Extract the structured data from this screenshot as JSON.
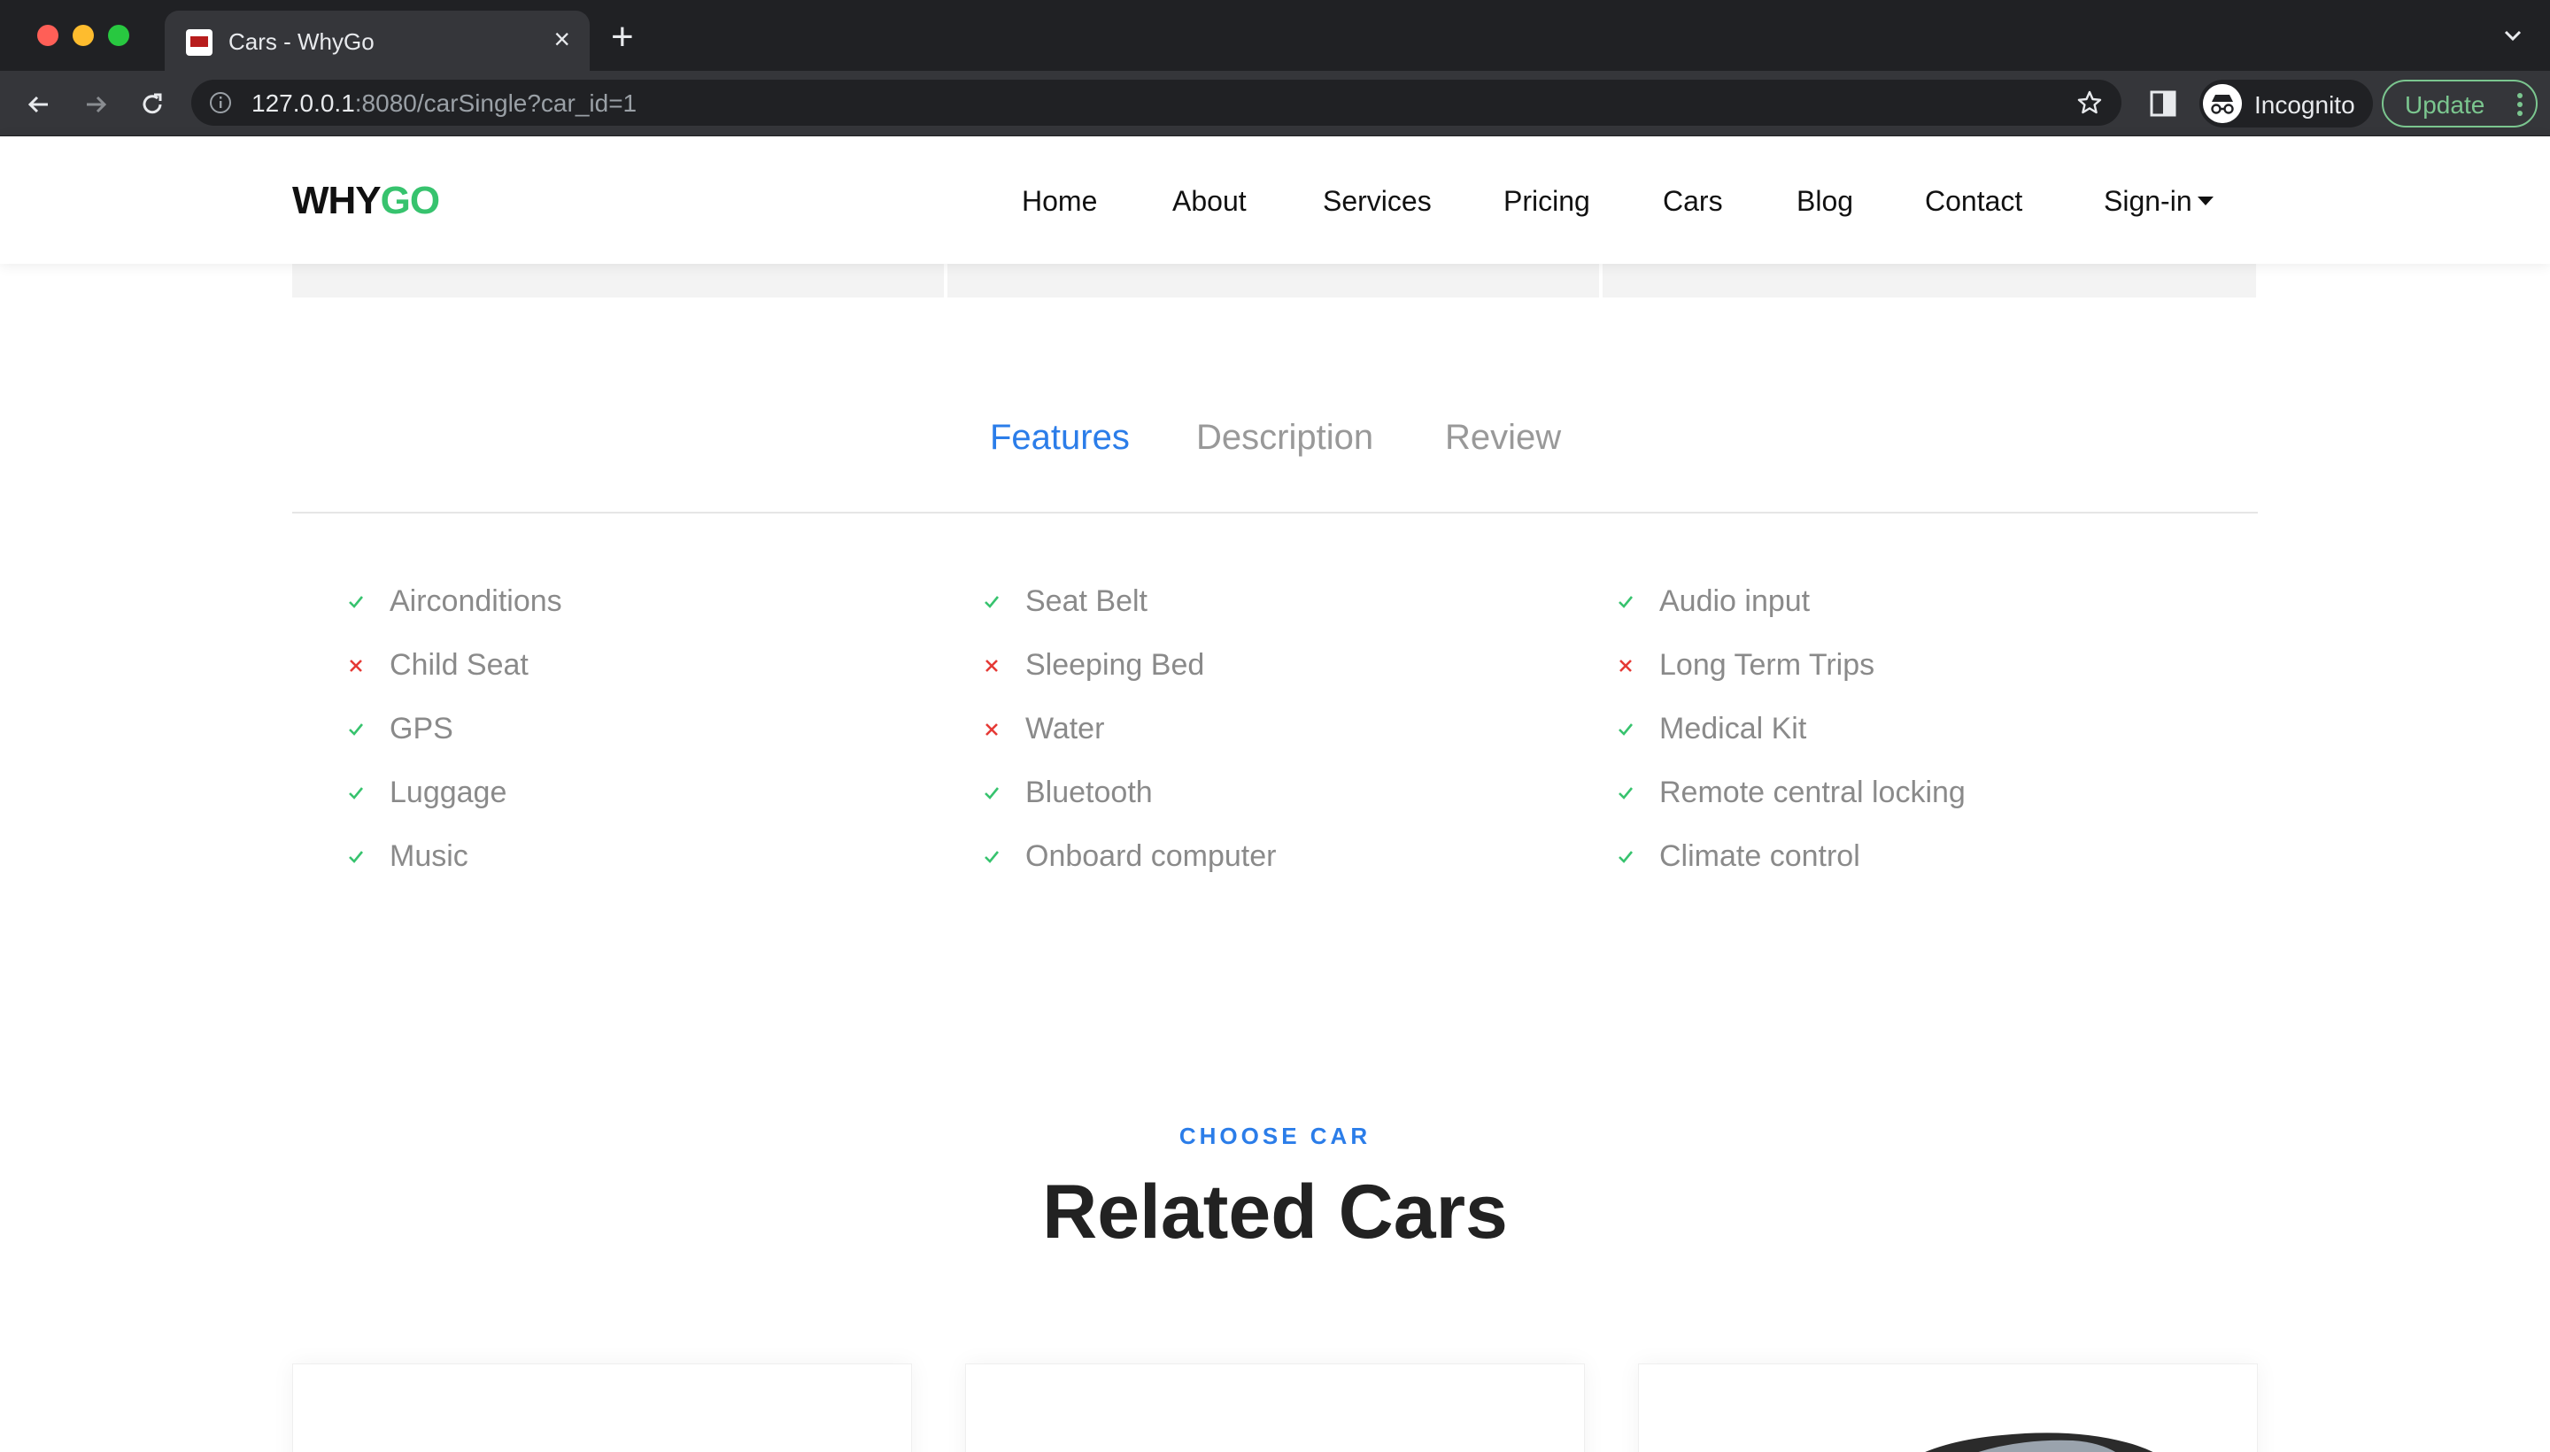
{
  "browser": {
    "tab_title": "Cars - WhyGo",
    "url_host": "127.0.0.1",
    "url_rest": ":8080/carSingle?car_id=1",
    "incognito_label": "Incognito",
    "update_label": "Update"
  },
  "site": {
    "logo_part1": "WHY",
    "logo_part2": "GO",
    "logo_accent_color": "#37c36e",
    "nav": [
      "Home",
      "About",
      "Services",
      "Pricing",
      "Cars",
      "Blog",
      "Contact",
      "Sign-in"
    ]
  },
  "tabs": {
    "items": [
      "Features",
      "Description",
      "Review"
    ],
    "active": "Features",
    "active_color": "#2b7de9"
  },
  "features": {
    "columns": [
      [
        {
          "label": "Airconditions",
          "available": true
        },
        {
          "label": "Child Seat",
          "available": false
        },
        {
          "label": "GPS",
          "available": true
        },
        {
          "label": "Luggage",
          "available": true
        },
        {
          "label": "Music",
          "available": true
        }
      ],
      [
        {
          "label": "Seat Belt",
          "available": true
        },
        {
          "label": "Sleeping Bed",
          "available": false
        },
        {
          "label": "Water",
          "available": false
        },
        {
          "label": "Bluetooth",
          "available": true
        },
        {
          "label": "Onboard computer",
          "available": true
        }
      ],
      [
        {
          "label": "Audio input",
          "available": true
        },
        {
          "label": "Long Term Trips",
          "available": false
        },
        {
          "label": "Medical Kit",
          "available": true
        },
        {
          "label": "Remote central locking",
          "available": true
        },
        {
          "label": "Climate control",
          "available": true
        }
      ]
    ],
    "check_color": "#37c36e",
    "cross_color": "#e53935"
  },
  "related": {
    "eyebrow": "CHOOSE CAR",
    "heading": "Related Cars"
  }
}
